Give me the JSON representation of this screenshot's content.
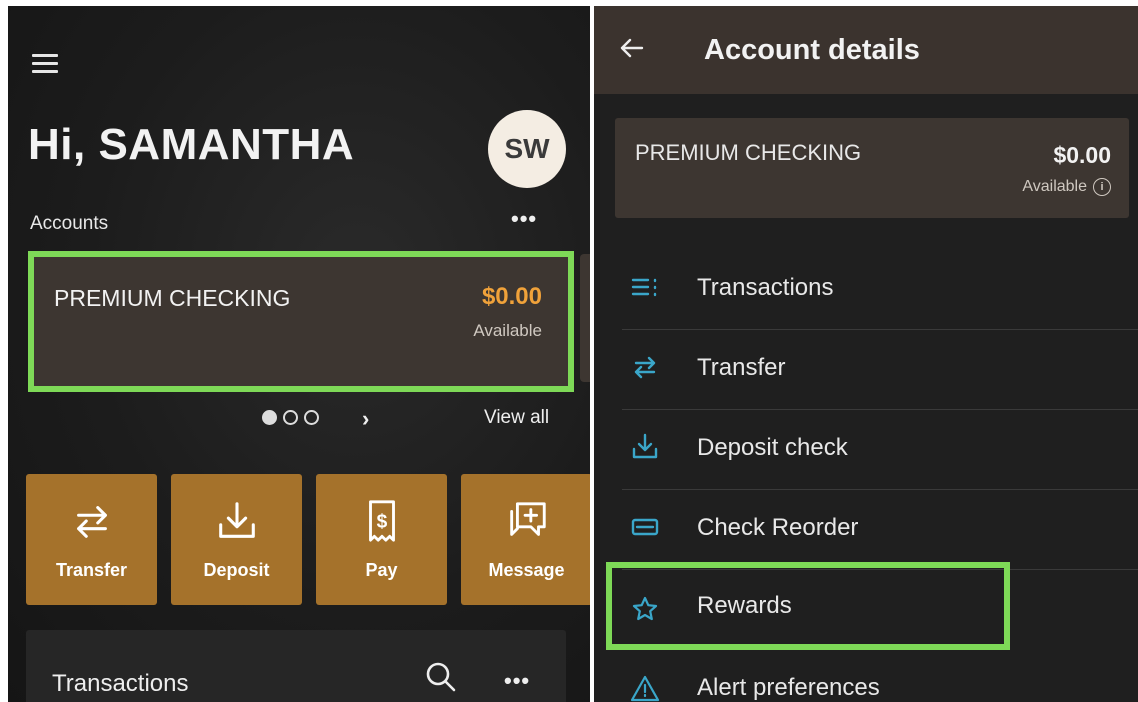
{
  "left_screen": {
    "greeting": "Hi, SAMANTHA",
    "avatar_initials": "SW",
    "accounts_label": "Accounts",
    "account_card": {
      "name": "PREMIUM CHECKING",
      "balance": "$0.00",
      "balance_label": "Available"
    },
    "pager": {
      "pages": 3,
      "current": 1
    },
    "view_all": "View all",
    "actions": [
      {
        "label": "Transfer",
        "icon": "transfer-icon"
      },
      {
        "label": "Deposit",
        "icon": "deposit-icon"
      },
      {
        "label": "Pay",
        "icon": "bill-pay-icon"
      },
      {
        "label": "Message",
        "icon": "message-icon"
      }
    ],
    "transactions_title": "Transactions"
  },
  "right_screen": {
    "title": "Account details",
    "account_card": {
      "name": "PREMIUM CHECKING",
      "balance": "$0.00",
      "balance_label": "Available"
    },
    "menu": [
      {
        "label": "Transactions",
        "icon": "list-icon"
      },
      {
        "label": "Transfer",
        "icon": "transfer-icon"
      },
      {
        "label": "Deposit check",
        "icon": "deposit-icon"
      },
      {
        "label": "Check Reorder",
        "icon": "checkbook-icon"
      },
      {
        "label": "Rewards",
        "icon": "star-icon"
      },
      {
        "label": "Alert preferences",
        "icon": "warning-icon"
      }
    ]
  },
  "colors": {
    "accent_gold": "#a5722b",
    "balance_orange": "#f0a23a",
    "highlight_green": "#7ed957",
    "card_brown": "#3d3631",
    "icon_teal": "#3aa6c9"
  }
}
